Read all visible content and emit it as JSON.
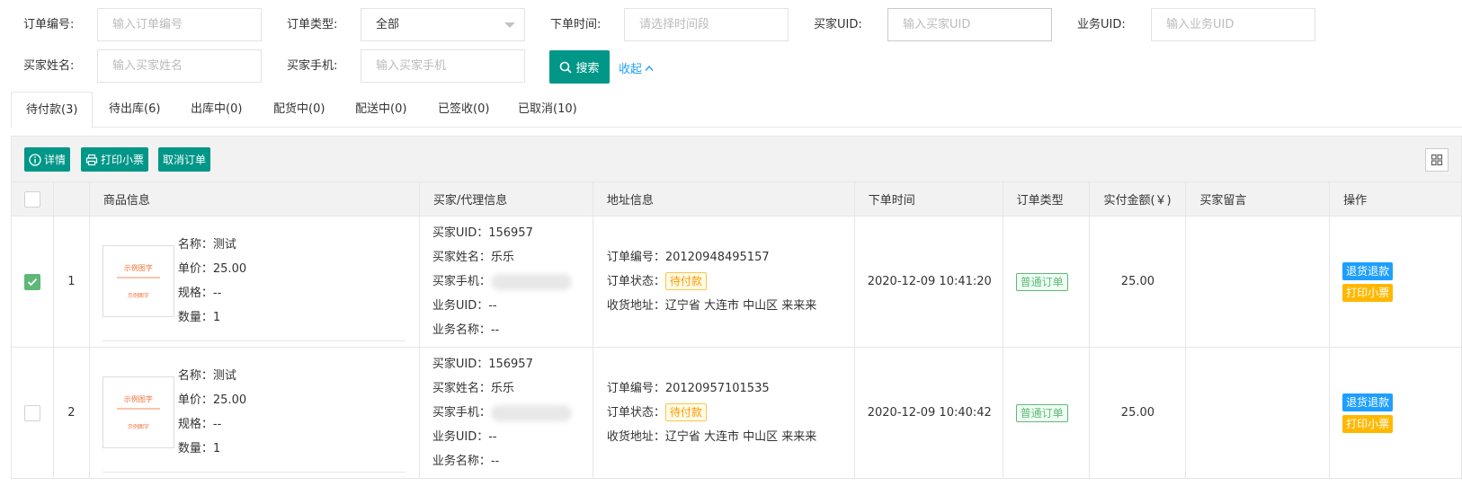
{
  "filters": {
    "order_no": {
      "label": "订单编号:",
      "placeholder": "输入订单编号"
    },
    "order_type": {
      "label": "订单类型:",
      "value": "全部"
    },
    "order_time": {
      "label": "下单时间:",
      "placeholder": "请选择时间段"
    },
    "buyer_uid": {
      "label": "买家UID:",
      "placeholder": "输入买家UID"
    },
    "biz_uid": {
      "label": "业务UID:",
      "placeholder": "输入业务UID"
    },
    "buyer_name": {
      "label": "买家姓名:",
      "placeholder": "输入买家姓名"
    },
    "buyer_phone": {
      "label": "买家手机:",
      "placeholder": "输入买家手机"
    },
    "search_label": "搜索",
    "collapse_label": "收起"
  },
  "tabs": [
    "待付款(3)",
    "待出库(6)",
    "出库中(0)",
    "配货中(0)",
    "配送中(0)",
    "已签收(0)",
    "已取消(10)"
  ],
  "toolbar": {
    "detail": "详情",
    "print": "打印小票",
    "cancel": "取消订单"
  },
  "columns": [
    "商品信息",
    "买家/代理信息",
    "地址信息",
    "下单时间",
    "订单类型",
    "实付金额(￥)",
    "买家留言",
    "操作"
  ],
  "thumb_text": {
    "brand": "示例图字",
    "tag": "示例图字"
  },
  "rows": [
    {
      "index": "1",
      "checked": true,
      "product": [
        "名称：测试",
        "单价：25.00",
        "规格：--",
        "数量：1"
      ],
      "buyer": {
        "uid": "买家UID：156957",
        "name": "买家姓名：乐乐",
        "phone": "买家手机：",
        "biz_uid": "业务UID：--",
        "biz_name": "业务名称：--"
      },
      "address": {
        "order_no": "订单编号：20120948495157",
        "status_label": "订单状态：",
        "status": "待付款",
        "addr": "收货地址：辽宁省 大连市 中山区 来来来"
      },
      "time": "2020-12-09 10:41:20",
      "type": "普通订单",
      "amount": "25.00",
      "remark": "",
      "ops": [
        "退货退款",
        "打印小票"
      ]
    },
    {
      "index": "2",
      "checked": false,
      "product": [
        "名称：测试",
        "单价：25.00",
        "规格：--",
        "数量：1"
      ],
      "buyer": {
        "uid": "买家UID：156957",
        "name": "买家姓名：乐乐",
        "phone": "买家手机：",
        "biz_uid": "业务UID：--",
        "biz_name": "业务名称：--"
      },
      "address": {
        "order_no": "订单编号：20120957101535",
        "status_label": "订单状态：",
        "status": "待付款",
        "addr": "收货地址：辽宁省 大连市 中山区 来来来"
      },
      "time": "2020-12-09 10:40:42",
      "type": "普通订单",
      "amount": "25.00",
      "remark": "",
      "ops": [
        "退货退款",
        "打印小票"
      ]
    }
  ]
}
